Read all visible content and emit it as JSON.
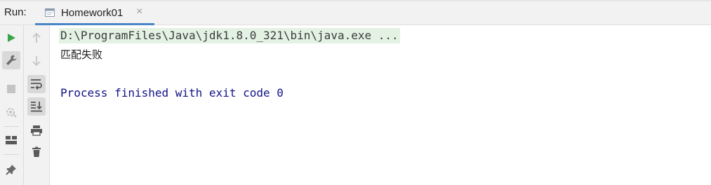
{
  "run_panel": {
    "label": "Run:",
    "tab": {
      "title": "Homework01",
      "close": "×",
      "icon": "application-icon"
    }
  },
  "toolbar_left": [
    {
      "name": "rerun-icon",
      "color": "#3aa547"
    },
    {
      "name": "wrench-icon"
    },
    {
      "name": "stop-icon"
    },
    {
      "name": "restore-layout-icon"
    },
    {
      "name": "layout-icon"
    },
    {
      "name": "pin-icon"
    }
  ],
  "toolbar_right": [
    {
      "name": "up-arrow-icon"
    },
    {
      "name": "down-arrow-icon"
    },
    {
      "name": "soft-wrap-icon"
    },
    {
      "name": "scroll-to-end-icon"
    },
    {
      "name": "print-icon"
    },
    {
      "name": "trash-icon"
    }
  ],
  "console": {
    "command_line": "D:\\ProgramFiles\\Java\\jdk1.8.0_321\\bin\\java.exe ...",
    "output_line": "匹配失败",
    "exit_line": "Process finished with exit code 0"
  },
  "colors": {
    "command_bg": "#e3f2e3",
    "exit_text": "#111188",
    "tab_underline": "#4a86c7"
  }
}
